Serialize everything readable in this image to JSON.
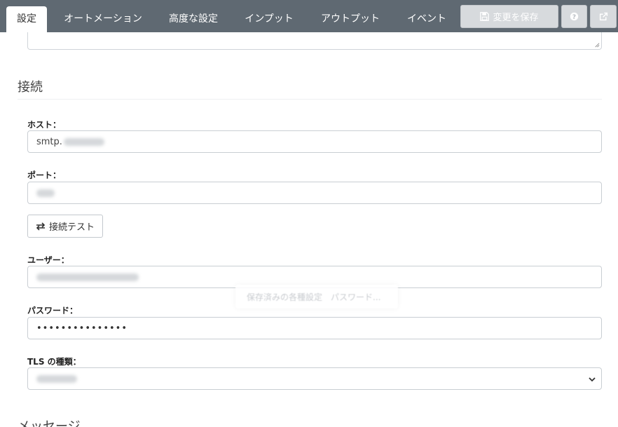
{
  "tabs": [
    {
      "label": "設定",
      "active": true
    },
    {
      "label": "オートメーション",
      "active": false
    },
    {
      "label": "高度な設定",
      "active": false
    },
    {
      "label": "インプット",
      "active": false
    },
    {
      "label": "アウトプット",
      "active": false
    },
    {
      "label": "イベント",
      "active": false
    }
  ],
  "toolbar": {
    "save_label": "変更を保存",
    "save_icon": "floppy-disk-icon",
    "help_icon": "question-circle-icon",
    "external_icon": "external-link-icon"
  },
  "section": {
    "title": "接続",
    "next_title": "メッセージ"
  },
  "fields": {
    "host_label": "ホスト：",
    "host_value": "smtp.",
    "port_label": "ポート：",
    "user_label": "ユーザー：",
    "password_label": "パスワード：",
    "password_value": "•••••••••••••••",
    "tls_label": "TLS の種類："
  },
  "test_button": {
    "label": "接続テスト",
    "icon": "exchange-arrows-icon"
  },
  "autofill_popup": {
    "text": "保存済みの各種設定　パスワード..."
  },
  "colors": {
    "topbar": "#5f6972",
    "button_disabled": "#d7dadd",
    "border": "#c9ced3"
  }
}
